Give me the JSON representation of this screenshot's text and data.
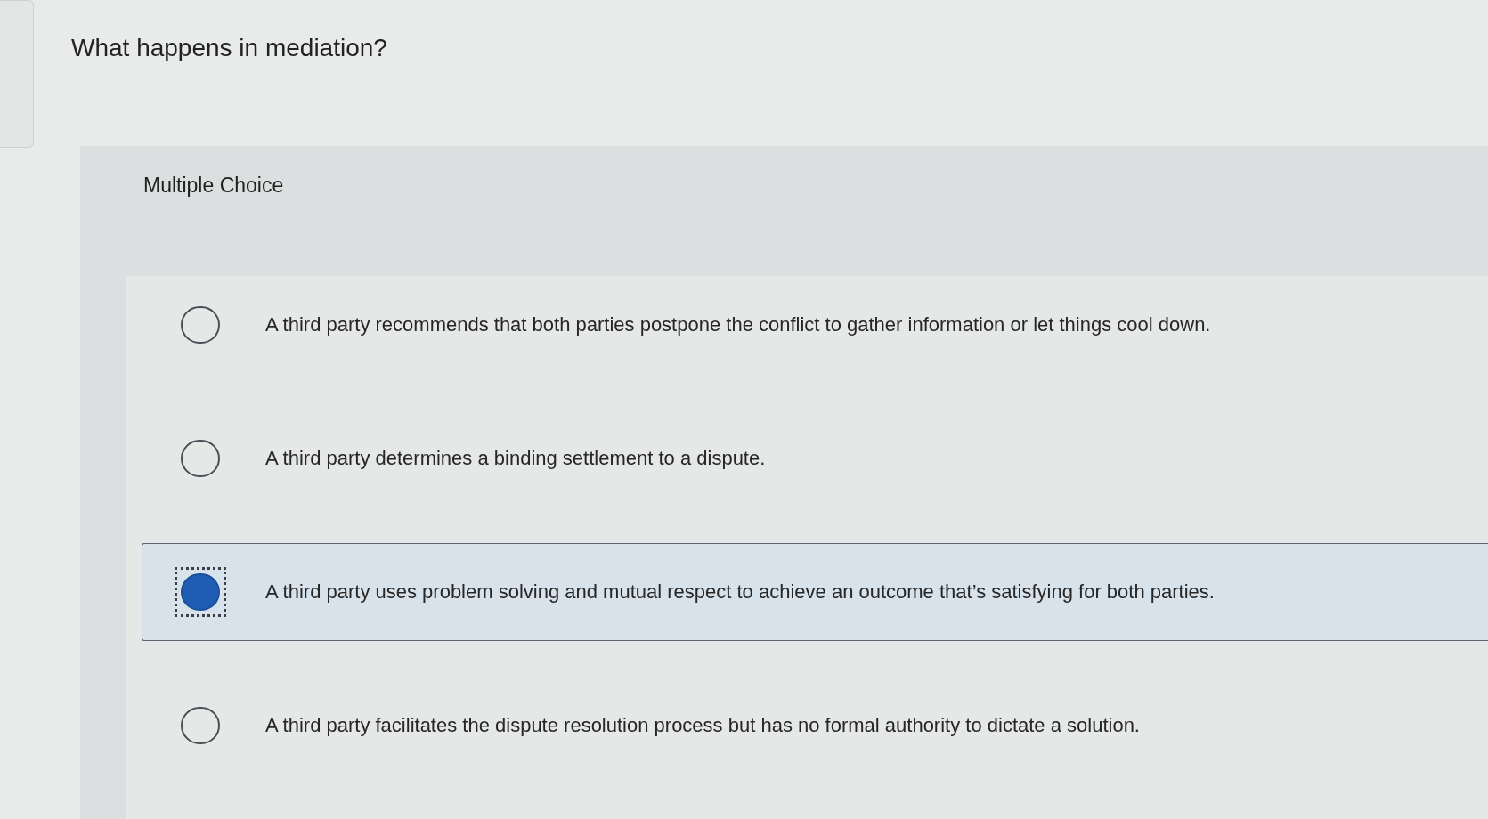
{
  "question": "What happens in mediation?",
  "question_type": "Multiple Choice",
  "options": [
    {
      "text": "A third party recommends that both parties postpone the conflict to gather information or let things cool down.",
      "selected": false,
      "focused": false
    },
    {
      "text": "A third party determines a binding settlement to a dispute.",
      "selected": false,
      "focused": false
    },
    {
      "text": "A third party uses problem solving and mutual respect to achieve an outcome that’s satisfying for both parties.",
      "selected": true,
      "focused": true
    },
    {
      "text": "A third party facilitates the dispute resolution process but has no formal authority to dictate a solution.",
      "selected": false,
      "focused": false
    }
  ]
}
